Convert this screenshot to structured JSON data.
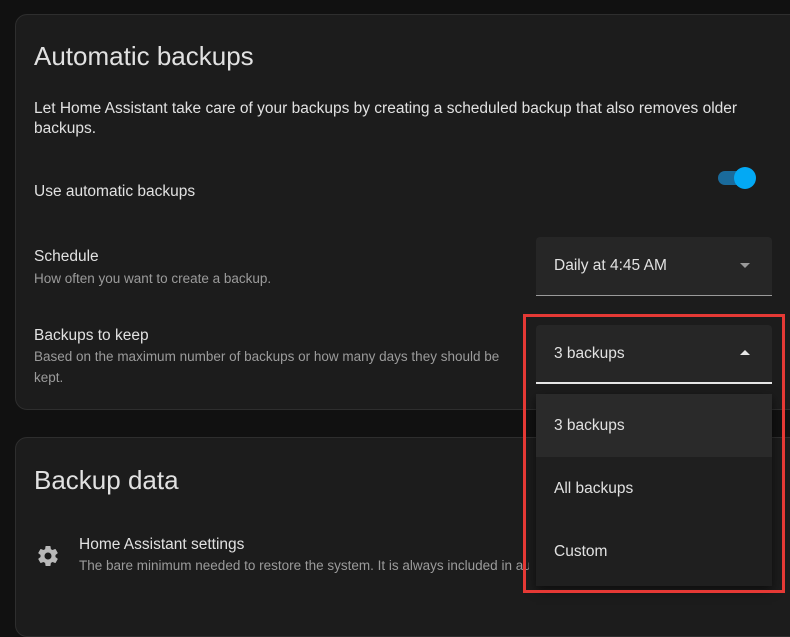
{
  "automatic_backups": {
    "title": "Automatic backups",
    "intro": "Let Home Assistant take care of your backups by creating a scheduled backup that also removes older backups.",
    "use_automatic": {
      "label": "Use automatic backups",
      "enabled": true
    },
    "schedule": {
      "label": "Schedule",
      "description": "How often you want to create a backup.",
      "value": "Daily at 4:45 AM"
    },
    "backups_to_keep": {
      "label": "Backups to keep",
      "description": "Based on the maximum number of backups or how many days they should be kept.",
      "value": "3 backups",
      "menu_open": true,
      "options": [
        "3 backups",
        "All backups",
        "Custom"
      ],
      "selected_index": 0
    }
  },
  "backup_data": {
    "title": "Backup data",
    "home_assistant_settings": {
      "icon": "gear-icon",
      "label": "Home Assistant settings",
      "description": "The bare minimum needed to restore the system. It is always included in automatic backups."
    }
  },
  "colors": {
    "background": "#111111",
    "card": "#1c1c1c",
    "accent": "#03a9f4",
    "highlight": "#e53935"
  }
}
